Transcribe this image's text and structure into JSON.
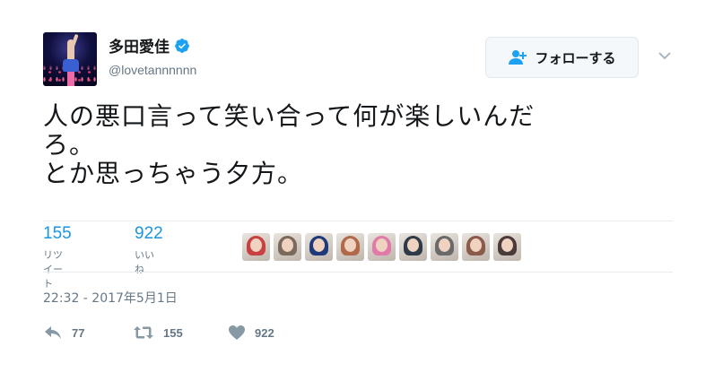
{
  "user": {
    "display_name": "多田愛佳",
    "handle": "@lovetannnnnn",
    "verified": true,
    "avatar_icon": "avatar-concert-photo"
  },
  "follow_button": {
    "label": "フォローする",
    "icon": "add-user-icon"
  },
  "tweet": {
    "lines": [
      "人の悪口言って笑い合って何が楽しいんだ",
      "ろ。",
      "とか思っちゃう夕方。"
    ]
  },
  "stats": {
    "retweets": {
      "count": "155",
      "label": "リツイート"
    },
    "likes": {
      "count": "922",
      "label": "いいね"
    }
  },
  "likers": [
    {
      "name": "liker-1",
      "color": "#c94040"
    },
    {
      "name": "liker-2",
      "color": "#7a6a5a"
    },
    {
      "name": "liker-3",
      "color": "#1f3a7a"
    },
    {
      "name": "liker-4",
      "color": "#b06a4a"
    },
    {
      "name": "liker-5",
      "color": "#e07aa8"
    },
    {
      "name": "liker-6",
      "color": "#2f3a48"
    },
    {
      "name": "liker-7",
      "color": "#6a6a6a"
    },
    {
      "name": "liker-8",
      "color": "#8a5a4a"
    },
    {
      "name": "liker-9",
      "color": "#4a3a3a"
    }
  ],
  "timestamp": "22:32 - 2017年5月1日",
  "actions": {
    "reply": {
      "count": "77",
      "icon": "reply-icon"
    },
    "retweet": {
      "count": "155",
      "icon": "retweet-icon"
    },
    "like": {
      "count": "922",
      "icon": "heart-icon"
    }
  },
  "colors": {
    "link_blue": "#1b95e0",
    "muted": "#657786",
    "border": "#e6ecf0",
    "verified": "#1da1f2"
  }
}
